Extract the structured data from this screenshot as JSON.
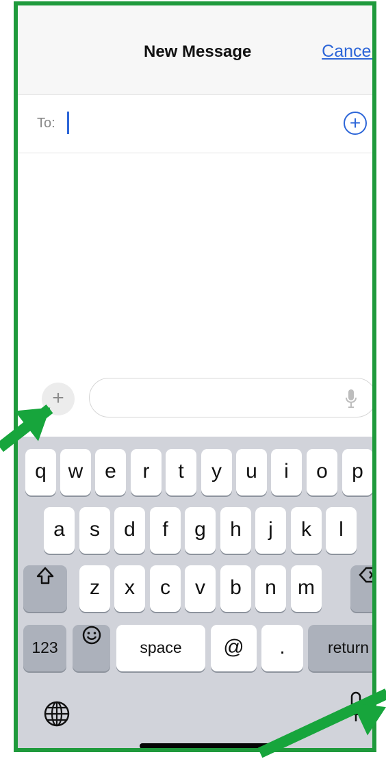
{
  "header": {
    "title": "New Message",
    "cancel": "Cancel"
  },
  "recipient": {
    "label": "To:",
    "value": "",
    "add_icon": "plus-circle-icon"
  },
  "composer": {
    "plus_icon": "plus-icon",
    "mic_icon": "microphone-icon",
    "placeholder": ""
  },
  "keyboard": {
    "row1": [
      "q",
      "w",
      "e",
      "r",
      "t",
      "y",
      "u",
      "i",
      "o",
      "p"
    ],
    "row2": [
      "a",
      "s",
      "d",
      "f",
      "g",
      "h",
      "j",
      "k",
      "l"
    ],
    "row3": [
      "z",
      "x",
      "c",
      "v",
      "b",
      "n",
      "m"
    ],
    "shift_icon": "shift-icon",
    "backspace_icon": "backspace-icon",
    "numbers": "123",
    "emoji_icon": "emoji-icon",
    "space": "space",
    "at": "@",
    "period": ".",
    "return": "return",
    "globe_icon": "globe-icon",
    "dictation_icon": "microphone-icon"
  },
  "colors": {
    "accent": "#2d66d8",
    "frame": "#1f9a3c",
    "keyboard": "#d1d3da"
  }
}
